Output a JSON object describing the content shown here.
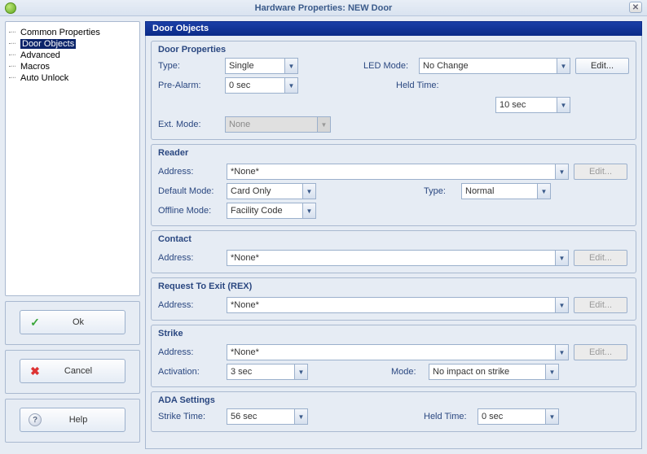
{
  "window": {
    "title": "Hardware Properties: NEW Door"
  },
  "nav": {
    "items": [
      {
        "label": "Common Properties"
      },
      {
        "label": "Door Objects",
        "selected": true
      },
      {
        "label": "Advanced"
      },
      {
        "label": "Macros"
      },
      {
        "label": "Auto Unlock"
      }
    ]
  },
  "buttons": {
    "ok": "Ok",
    "cancel": "Cancel",
    "help": "Help"
  },
  "section_title": "Door Objects",
  "door_props": {
    "legend": "Door Properties",
    "type_label": "Type:",
    "type_value": "Single",
    "led_label": "LED Mode:",
    "led_value": "No Change",
    "edit": "Edit...",
    "prealarm_label": "Pre-Alarm:",
    "prealarm_value": "0 sec",
    "held_label": "Held Time:",
    "held_value": "10 sec",
    "extmode_label": "Ext. Mode:",
    "extmode_value": "None"
  },
  "reader": {
    "legend": "Reader",
    "address_label": "Address:",
    "address_value": "*None*",
    "edit": "Edit...",
    "defmode_label": "Default Mode:",
    "defmode_value": "Card Only",
    "type_label": "Type:",
    "type_value": "Normal",
    "offline_label": "Offline Mode:",
    "offline_value": "Facility Code"
  },
  "contact": {
    "legend": "Contact",
    "address_label": "Address:",
    "address_value": "*None*",
    "edit": "Edit..."
  },
  "rex": {
    "legend": "Request To Exit (REX)",
    "address_label": "Address:",
    "address_value": "*None*",
    "edit": "Edit..."
  },
  "strike": {
    "legend": "Strike",
    "address_label": "Address:",
    "address_value": "*None*",
    "edit": "Edit...",
    "activation_label": "Activation:",
    "activation_value": "3 sec",
    "mode_label": "Mode:",
    "mode_value": "No impact on strike"
  },
  "ada": {
    "legend": "ADA Settings",
    "strike_label": "Strike Time:",
    "strike_value": "56 sec",
    "held_label": "Held Time:",
    "held_value": "0 sec"
  }
}
